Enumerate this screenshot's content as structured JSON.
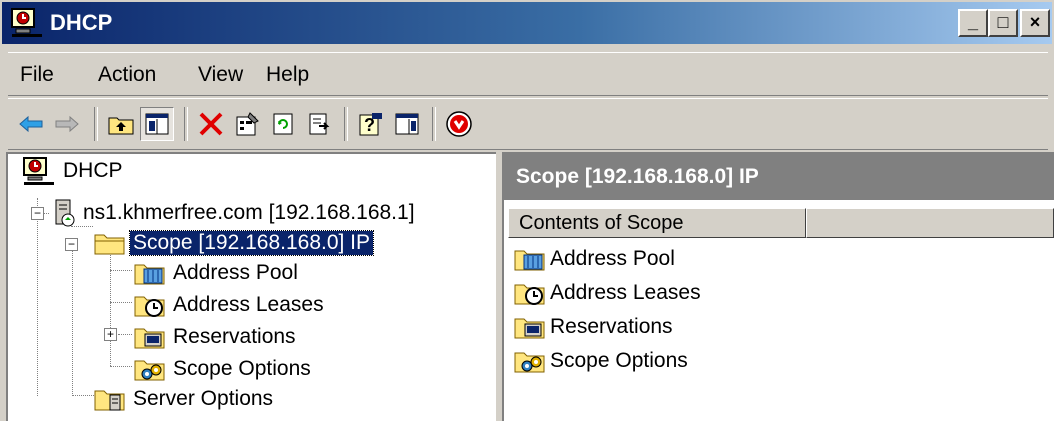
{
  "window": {
    "title": "DHCP",
    "controls": {
      "minimize": "_",
      "maximize": "□",
      "close": "×"
    }
  },
  "menu": [
    {
      "label": "File"
    },
    {
      "label": "Action"
    },
    {
      "label": "View"
    },
    {
      "label": "Help"
    }
  ],
  "toolbar": {
    "buttons": [
      "back-icon",
      "forward-icon",
      "up-one-level-icon",
      "show-hide-console-tree-icon",
      "delete-icon",
      "properties-icon",
      "refresh-icon",
      "export-list-icon",
      "help-icon",
      "show-hide-action-pane-icon",
      "stop-icon"
    ]
  },
  "tree": {
    "root": "DHCP",
    "server": "ns1.khmerfree.com [192.168.168.1]",
    "scope": "Scope [192.168.168.0] IP",
    "children": [
      "Address Pool",
      "Address Leases",
      "Reservations",
      "Scope Options"
    ],
    "server_options": "Server Options"
  },
  "details": {
    "header": "Scope [192.168.168.0] IP",
    "column": "Contents of Scope",
    "items": [
      "Address Pool",
      "Address Leases",
      "Reservations",
      "Scope Options"
    ]
  }
}
